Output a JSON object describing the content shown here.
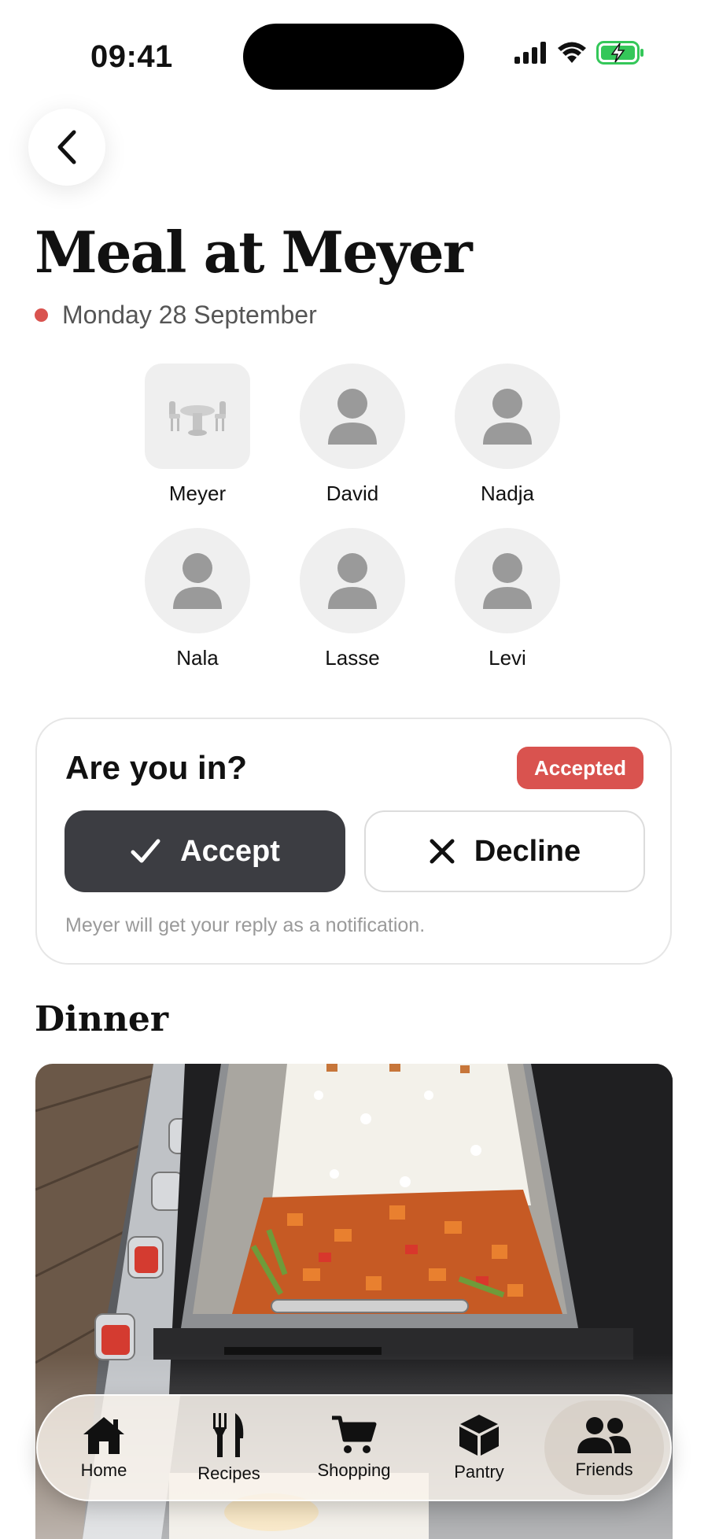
{
  "status_bar": {
    "time": "09:41"
  },
  "page": {
    "title": "Meal at Meyer",
    "date": "Monday 28 September",
    "accent_color": "#d9534f"
  },
  "guests": [
    {
      "name": "Meyer",
      "icon": "dining-table-icon"
    },
    {
      "name": "David",
      "icon": "person-icon"
    },
    {
      "name": "Nadja",
      "icon": "person-icon"
    },
    {
      "name": "Nala",
      "icon": "person-icon"
    },
    {
      "name": "Lasse",
      "icon": "person-icon"
    },
    {
      "name": "Levi",
      "icon": "person-icon"
    }
  ],
  "rsvp": {
    "question": "Are you in?",
    "status": "Accepted",
    "accept_label": "Accept",
    "decline_label": "Decline",
    "note": "Meyer will get your reply as a notification."
  },
  "dinner": {
    "section_title": "Dinner"
  },
  "tabbar": {
    "items": [
      {
        "label": "Home",
        "icon": "house-icon",
        "active": false
      },
      {
        "label": "Recipes",
        "icon": "fork-knife-icon",
        "active": false
      },
      {
        "label": "Shopping",
        "icon": "cart-icon",
        "active": false
      },
      {
        "label": "Pantry",
        "icon": "box-icon",
        "active": false
      },
      {
        "label": "Friends",
        "icon": "people-icon",
        "active": true
      }
    ]
  }
}
